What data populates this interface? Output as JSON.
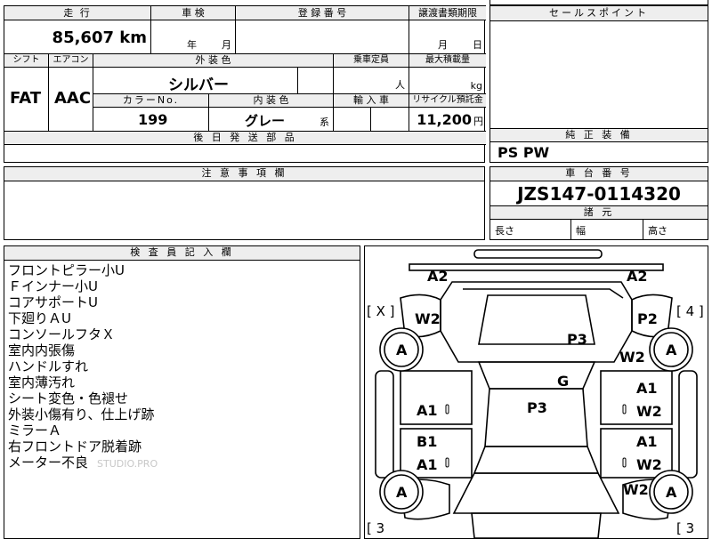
{
  "left_table": {
    "mileage_label": "走 行",
    "mileage_value": "85,607 km",
    "inspection_label": "車 検",
    "inspection_year": "年",
    "inspection_month": "月",
    "registration_label": "登 録 番 号",
    "transfer_doc_label": "譲渡書類期限",
    "transfer_month": "月",
    "transfer_day": "日",
    "shift_label": "シフト",
    "shift_value": "FAT",
    "ac_label": "エアコン",
    "ac_value": "AAC",
    "exterior_color_label": "外 装 色",
    "exterior_color_value": "シルバー",
    "capacity_label": "乗車定員",
    "capacity_unit": "人",
    "max_load_label": "最大積載量",
    "max_load_unit": "kg",
    "color_no_label": "カラーNo.",
    "color_no_value": "199",
    "interior_color_label": "内 装 色",
    "interior_color_value": "グレー",
    "interior_color_suffix": "系",
    "import_label": "輸 入 車",
    "recycle_label": "リサイクル預託金",
    "recycle_value": "11,200",
    "recycle_unit": "円",
    "later_parts_label": "後 日 発 送 部 品",
    "notice_label": "注 意 事 項 欄"
  },
  "right_panel": {
    "sales_point_label": "セールスポイント",
    "equipment_label": "純 正 装 備",
    "equipment_value": "PS PW",
    "chassis_label": "車 台 番 号",
    "chassis_value": "JZS147-0114320",
    "dimensions_label": "諸 元",
    "length_label": "長さ",
    "width_label": "幅",
    "height_label": "高さ"
  },
  "inspector": {
    "title": "検 査 員 記 入 欄",
    "notes": [
      "フロントピラー小U",
      "Ｆインナー小U",
      "コアサポートU",
      "下廻りＡU",
      "コンソールフタＸ",
      "室内内張傷",
      "ハンドルすれ",
      "室内薄汚れ",
      "シート変色・色褪せ",
      "外装小傷有り、仕上げ跡",
      "ミラーＡ",
      "右フロントドア脱着跡",
      "メーター不良"
    ],
    "watermark": "STUDIO.PRO"
  },
  "diagram": {
    "marks": {
      "a2_left": "A2",
      "a2_right": "A2",
      "bracket_left": "[ X ]",
      "bracket_right": "[ 4 ]",
      "w2_front_left": "W2",
      "p2_front_right": "P2",
      "tire_front_left": "A",
      "tire_front_right": "A",
      "p3_hood": "P3",
      "w2_fender_right": "W2",
      "g_windshield": "G",
      "a1_left_front_door": "A1",
      "p3_roof": "P3",
      "a1_right_front_door": "A1",
      "w2_right_front_door": "W2",
      "b1_left": "B1",
      "a1_left_rear_door": "A1",
      "a1_right_rear_door": "A1",
      "w2_right_rear_door": "W2",
      "w2_rear_right": "W2",
      "tire_rear_left": "A",
      "tire_rear_right": "A",
      "bracket_bottom_left": "[ 3",
      "bracket_bottom_right": "[ 3"
    }
  }
}
